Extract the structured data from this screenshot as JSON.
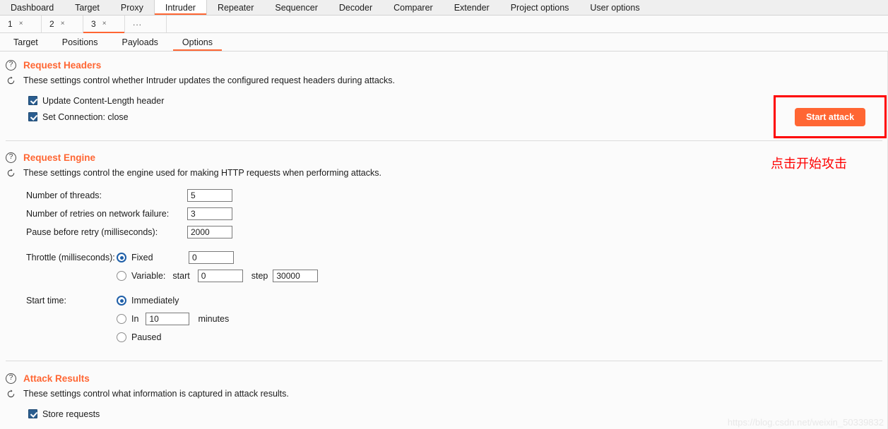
{
  "main_tabs": [
    {
      "label": "Dashboard",
      "active": false
    },
    {
      "label": "Target",
      "active": false
    },
    {
      "label": "Proxy",
      "active": false
    },
    {
      "label": "Intruder",
      "active": true
    },
    {
      "label": "Repeater",
      "active": false
    },
    {
      "label": "Sequencer",
      "active": false
    },
    {
      "label": "Decoder",
      "active": false
    },
    {
      "label": "Comparer",
      "active": false
    },
    {
      "label": "Extender",
      "active": false
    },
    {
      "label": "Project options",
      "active": false
    },
    {
      "label": "User options",
      "active": false
    }
  ],
  "attack_tabs": [
    {
      "label": "1",
      "close": "×",
      "active": false
    },
    {
      "label": "2",
      "close": "×",
      "active": false
    },
    {
      "label": "3",
      "close": "×",
      "active": true
    }
  ],
  "attack_tabs_more": "...",
  "sub_tabs": [
    {
      "label": "Target",
      "active": false
    },
    {
      "label": "Positions",
      "active": false
    },
    {
      "label": "Payloads",
      "active": false
    },
    {
      "label": "Options",
      "active": true
    }
  ],
  "toolbar": {
    "start_attack_label": "Start attack",
    "annotation_cn": "点击开始攻击"
  },
  "sections": {
    "request_headers": {
      "title": "Request Headers",
      "description": "These settings control whether Intruder updates the configured request headers during attacks.",
      "checkboxes": [
        {
          "label": "Update Content-Length header",
          "checked": true
        },
        {
          "label": "Set Connection: close",
          "checked": true
        }
      ]
    },
    "request_engine": {
      "title": "Request Engine",
      "description": "These settings control the engine used for making HTTP requests when performing attacks.",
      "fields": [
        {
          "label": "Number of threads:",
          "value": "5"
        },
        {
          "label": "Number of retries on network failure:",
          "value": "3"
        },
        {
          "label": "Pause before retry (milliseconds):",
          "value": "2000"
        }
      ],
      "throttle": {
        "label": "Throttle (milliseconds):",
        "fixed_label": "Fixed",
        "fixed_selected": true,
        "fixed_value": "0",
        "variable_label": "Variable:",
        "variable_selected": false,
        "start_label": "start",
        "start_value": "0",
        "step_label": "step",
        "step_value": "30000"
      },
      "start_time": {
        "label": "Start time:",
        "options": [
          {
            "label": "Immediately",
            "selected": true
          },
          {
            "label": "In",
            "selected": false,
            "value": "10",
            "suffix": "minutes"
          },
          {
            "label": "Paused",
            "selected": false
          }
        ]
      }
    },
    "attack_results": {
      "title": "Attack Results",
      "description": "These settings control what information is captured in attack results.",
      "checkboxes": [
        {
          "label": "Store requests",
          "checked": true
        }
      ]
    }
  },
  "watermark": "https://blog.csdn.net/weixin_50339832",
  "colors": {
    "accent_orange": "#ff6633",
    "annotation_red": "#fe0000",
    "checkbox_blue": "#2a5d8f",
    "radio_blue": "#1f5fa8"
  }
}
